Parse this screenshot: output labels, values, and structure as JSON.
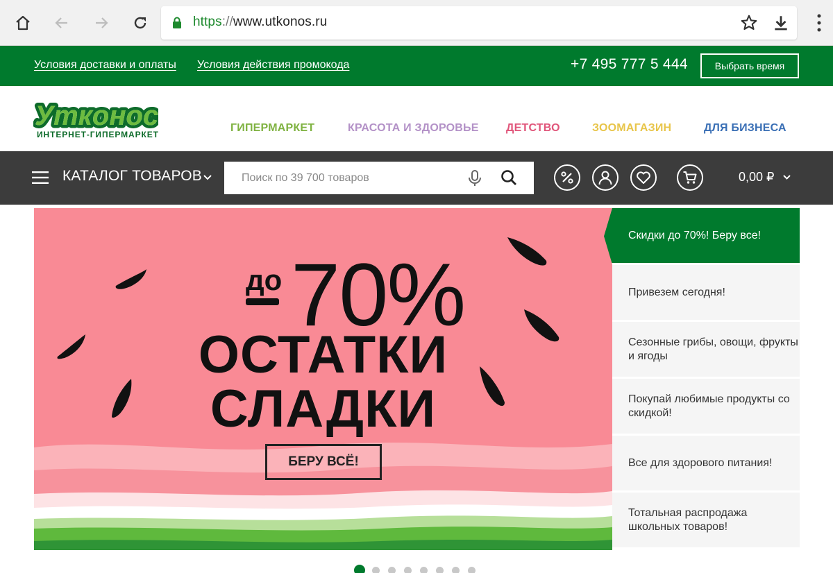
{
  "browser": {
    "url_scheme": "https",
    "url_sep": "://",
    "url_host": "www.utkonos.ru"
  },
  "topbar": {
    "delivery_link": "Условия доставки и оплаты",
    "promo_link": "Условия действия промокода",
    "phone": "+7 495 777 5 444",
    "time_button": "Выбрать время"
  },
  "logo": {
    "name": "Утконос",
    "subtitle": "ИНТЕРНЕТ-ГИПЕРМАРКЕТ"
  },
  "categories": [
    {
      "label": "ГИПЕРМАРКЕТ",
      "color": "#7fb241"
    },
    {
      "label": "КРАСОТА И ЗДОРОВЬЕ",
      "color": "#b391c7"
    },
    {
      "label": "ДЕТСТВО",
      "color": "#e0557a"
    },
    {
      "label": "ЗООМАГАЗИН",
      "color": "#e8c54a"
    },
    {
      "label": "ДЛЯ БИЗНЕСА",
      "color": "#3a6fb5"
    }
  ],
  "toolbar": {
    "catalog_label": "КАТАЛОГ ТОВАРОВ",
    "search_placeholder": "Поиск по 39 700 товаров",
    "cart_total": "0,00 ₽"
  },
  "banner": {
    "prefix": "до",
    "percent": "70%",
    "line1": "ОСТАТКИ",
    "line2": "СЛАДКИ",
    "cta": "БЕРУ ВСЁ!"
  },
  "promos": [
    {
      "label": "Скидки до 70%! Беру все!",
      "active": true
    },
    {
      "label": "Привезем сегодня!",
      "active": false
    },
    {
      "label": "Сезонные грибы, овощи, фрукты и ягоды",
      "active": false
    },
    {
      "label": "Покупай любимые продукты со скидкой!",
      "active": false
    },
    {
      "label": "Все для здорового питания!",
      "active": false
    },
    {
      "label": "Тотальная распродажа школьных товаров!",
      "active": false
    }
  ],
  "carousel": {
    "total": 8,
    "active_index": 0
  },
  "colors": {
    "brand_green": "#007a2d",
    "dark_bar": "#3c3c3c",
    "banner_pink": "#f98a95"
  }
}
